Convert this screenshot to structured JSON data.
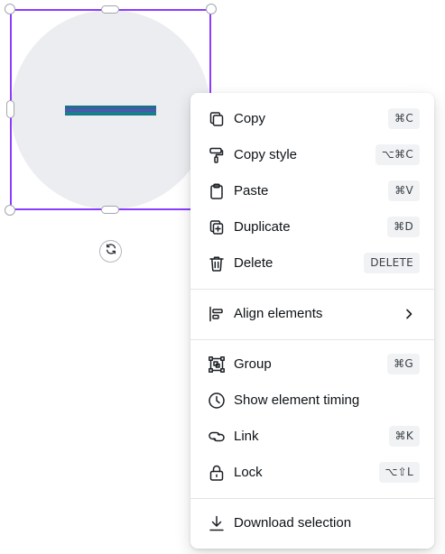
{
  "canvas": {
    "selection_color": "#8b3dff",
    "shape_fill": "#ebedf0",
    "bar_color": "#1f6f8b",
    "rotate_icon": "rotate-icon"
  },
  "context_menu": {
    "groups": [
      {
        "items": [
          {
            "label": "Copy",
            "icon": "copy-icon",
            "shortcut": "⌘C"
          },
          {
            "label": "Copy style",
            "icon": "paint-roller-icon",
            "shortcut": "⌥⌘C"
          },
          {
            "label": "Paste",
            "icon": "clipboard-icon",
            "shortcut": "⌘V"
          },
          {
            "label": "Duplicate",
            "icon": "duplicate-icon",
            "shortcut": "⌘D"
          },
          {
            "label": "Delete",
            "icon": "trash-icon",
            "shortcut": "DELETE"
          }
        ]
      },
      {
        "items": [
          {
            "label": "Align elements",
            "icon": "align-icon",
            "submenu": true
          }
        ]
      },
      {
        "items": [
          {
            "label": "Group",
            "icon": "group-icon",
            "shortcut": "⌘G"
          },
          {
            "label": "Show element timing",
            "icon": "clock-icon"
          },
          {
            "label": "Link",
            "icon": "link-icon",
            "shortcut": "⌘K"
          },
          {
            "label": "Lock",
            "icon": "lock-icon",
            "shortcut": "⌥⇧L"
          }
        ]
      },
      {
        "items": [
          {
            "label": "Download selection",
            "icon": "download-icon"
          }
        ]
      }
    ]
  }
}
